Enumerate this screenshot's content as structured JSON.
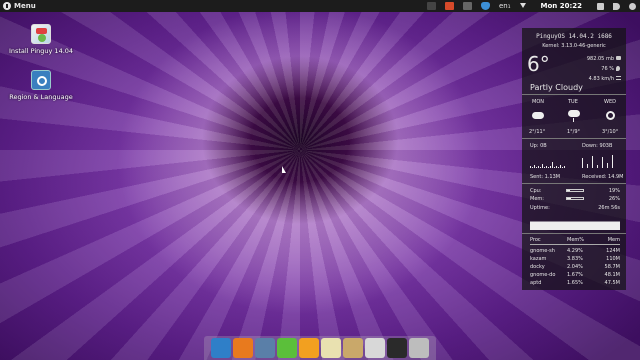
{
  "topbar": {
    "menu_label": "Menu",
    "keyboard_layout": "en₁",
    "clock": "Mon 20:22",
    "tray_icons": [
      "screenshot-icon",
      "webcam-icon",
      "window-list-icon",
      "shield-icon"
    ],
    "colors": {
      "bar": "#1c1c1c"
    }
  },
  "desktop_icons": [
    {
      "label": "Install Pinguy 14.04",
      "icon": "installer-icon"
    },
    {
      "label": "Region & Language",
      "icon": "region-language-icon"
    }
  ],
  "conky": {
    "os": "PinguyOS 14.04.2 i686",
    "kernel": "Kernel: 3.13.0-46-generic",
    "temperature": "6°",
    "pressure": "982.05 mb",
    "humidity": "76 %",
    "wind": "4.83 km/h",
    "condition": "Partly Cloudy",
    "forecast": [
      {
        "day": "MON",
        "icon": "cloud-icon",
        "range": "2°/11°"
      },
      {
        "day": "TUE",
        "icon": "rain-icon",
        "range": "1°/9°"
      },
      {
        "day": "WED",
        "icon": "sun-cloud-icon",
        "range": "3°/10°"
      }
    ],
    "network": {
      "up": "Up: 0B",
      "down": "Down: 903B",
      "sent": "Sent: 1.13M",
      "received": "Received: 14.9M"
    },
    "cpu": {
      "label": "Cpu:",
      "value": "19%",
      "fraction": 0.19
    },
    "mem": {
      "label": "Mem:",
      "value": "26%",
      "fraction": 0.26
    },
    "uptime": {
      "label": "Uptime:",
      "value": "26m 56s"
    },
    "processes": {
      "headers": [
        "Proc",
        "Mem%",
        "Mem"
      ],
      "rows": [
        [
          "gnome-sh",
          "4.29%",
          "124M"
        ],
        [
          "kazam",
          "3.83%",
          "110M"
        ],
        [
          "docky",
          "2.04%",
          "58.7M"
        ],
        [
          "gnome-do",
          "1.67%",
          "48.1M"
        ],
        [
          "aptd",
          "1.65%",
          "47.5M"
        ]
      ]
    }
  },
  "dock": {
    "items": [
      {
        "name": "anchor-icon",
        "color": "#2f7fc8"
      },
      {
        "name": "firefox-icon",
        "color": "#e87a1e"
      },
      {
        "name": "thunderbird-icon",
        "color": "#5a7fa8"
      },
      {
        "name": "hashtag-icon",
        "color": "#5bbf3a"
      },
      {
        "name": "rss-icon",
        "color": "#f2a020"
      },
      {
        "name": "video-icon",
        "color": "#e9e1b0"
      },
      {
        "name": "archive-icon",
        "color": "#c9a86a"
      },
      {
        "name": "mixer-icon",
        "color": "#d8d8d8"
      },
      {
        "name": "terminal-icon",
        "color": "#2a2a2a"
      },
      {
        "name": "trash-icon",
        "color": "#bdbdbd"
      }
    ]
  }
}
